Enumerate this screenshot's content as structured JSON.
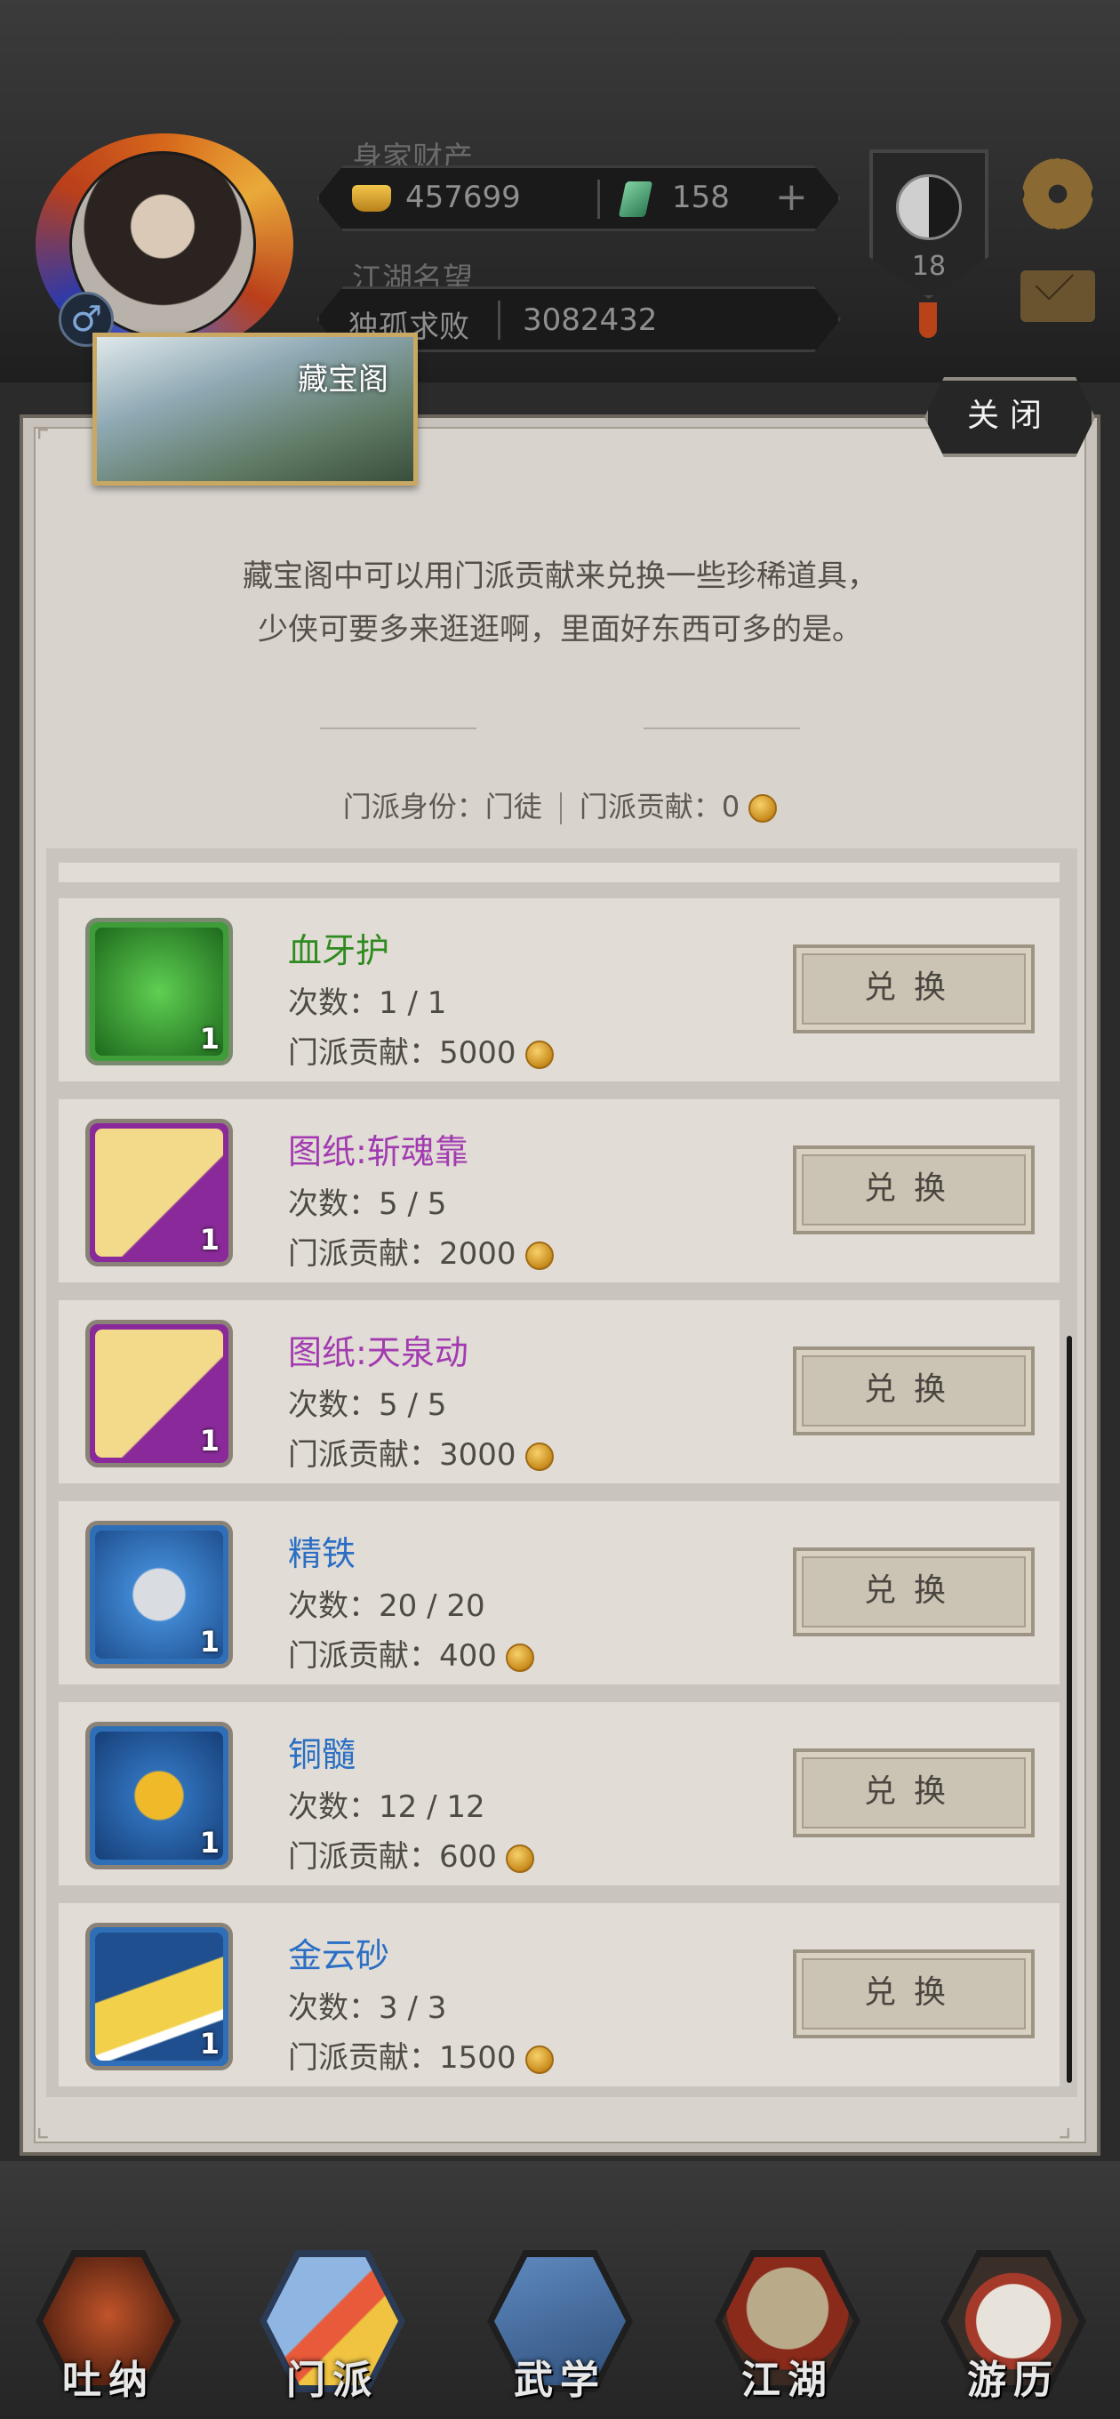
{
  "hud": {
    "assets_label": "身家财产",
    "gold": "457699",
    "jade": "158",
    "reputation_label": "江湖名望",
    "reputation_title": "独孤求败",
    "reputation_value": "3082432",
    "rank": "18",
    "gender_symbol": "♂"
  },
  "store": {
    "title": "藏宝阁",
    "close_label": "关闭",
    "intro_line1": "藏宝阁中可以用门派贡献来兑换一些珍稀道具，",
    "intro_line2": "少侠可要多来逛逛啊，里面好东西可多的是。",
    "identity_label": "门派身份：门徒",
    "contribution_label": "门派贡献：0"
  },
  "items": [
    {
      "name": "血牙护",
      "uses": "次数：1 / 1",
      "cost": "门派贡献：5000",
      "count": "1",
      "rarity": "green",
      "name_color": "#2f8a1f",
      "button": "兑换"
    },
    {
      "name": "图纸:斩魂靠",
      "uses": "次数：5 / 5",
      "cost": "门派贡献：2000",
      "count": "1",
      "rarity": "purple",
      "name_color": "#a23bb0",
      "button": "兑换"
    },
    {
      "name": "图纸:天泉动",
      "uses": "次数：5 / 5",
      "cost": "门派贡献：3000",
      "count": "1",
      "rarity": "purple",
      "name_color": "#a23bb0",
      "button": "兑换"
    },
    {
      "name": "精铁",
      "uses": "次数：20 / 20",
      "cost": "门派贡献：400",
      "count": "1",
      "rarity": "blue",
      "name_color": "#2a6fc4",
      "button": "兑换"
    },
    {
      "name": "铜髓",
      "uses": "次数：12 / 12",
      "cost": "门派贡献：600",
      "count": "1",
      "rarity": "blue",
      "name_color": "#2a6fc4",
      "button": "兑换"
    },
    {
      "name": "金云砂",
      "uses": "次数：3 / 3",
      "cost": "门派贡献：1500",
      "count": "1",
      "rarity": "blue",
      "name_color": "#2a6fc4",
      "button": "兑换"
    }
  ],
  "nav": {
    "tabs": [
      "吐纳",
      "门派",
      "武学",
      "江湖",
      "游历"
    ]
  }
}
